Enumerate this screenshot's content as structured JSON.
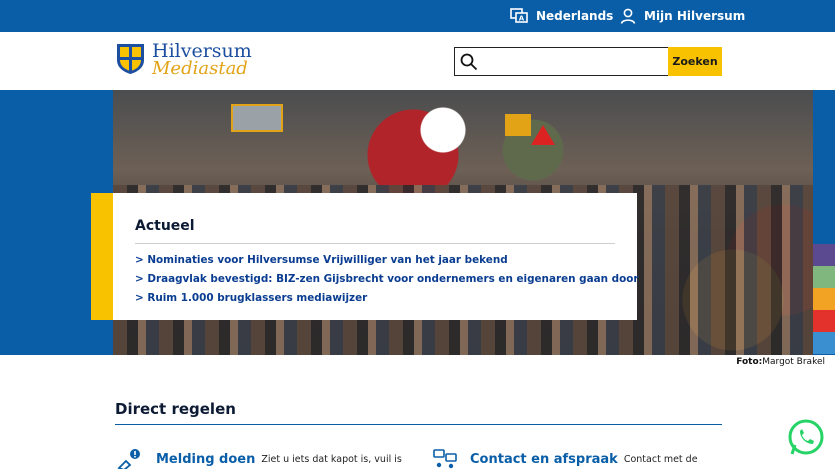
{
  "topbar": {
    "language_label": "Nederlands",
    "account_label": "Mijn Hilversum"
  },
  "logo": {
    "name": "Hilversum",
    "tagline": "Mediastad"
  },
  "search": {
    "value": "",
    "placeholder": "",
    "button_label": "Zoeken"
  },
  "actueel": {
    "heading": "Actueel",
    "items": [
      "> Nominaties voor Hilversumse Vrijwilliger van het jaar bekend",
      "> Draagvlak bevestigd: BIZ-zen Gijsbrecht voor ondernemers en eigenaren gaan door",
      "> Ruim 1.000 brugklassers mediawijzer"
    ]
  },
  "photo_credit": {
    "label": "Foto:",
    "name": "Margot Brakel"
  },
  "direct_regelen": {
    "heading": "Direct regelen",
    "items": [
      {
        "title": "Melding doen",
        "description": "Ziet u iets dat kapot is, vuil is",
        "icon": "report-issue-icon"
      },
      {
        "title": "Contact en afspraak",
        "description": "Contact met de",
        "icon": "contact-icon"
      }
    ]
  },
  "side_stripes": [
    "#5b4a8f",
    "#7fb77e",
    "#f3a324",
    "#e2322b",
    "#3a8fd0"
  ],
  "colors": {
    "brand_blue": "#0a5ea8",
    "accent_yellow": "#f9c200",
    "link_blue": "#0a3d91",
    "whatsapp_green": "#25d366"
  }
}
